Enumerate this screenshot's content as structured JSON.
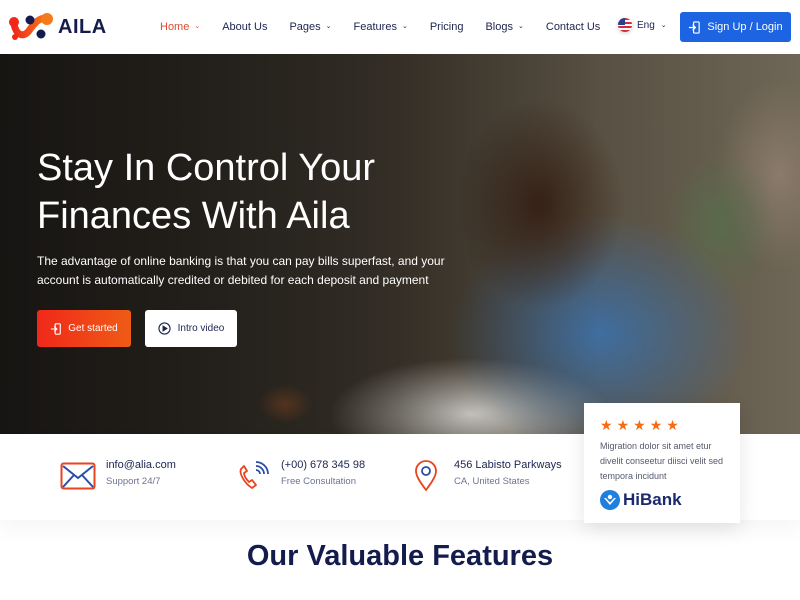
{
  "header": {
    "brand": "AILA",
    "nav": [
      {
        "label": "Home",
        "has_dropdown": true,
        "active": true
      },
      {
        "label": "About Us",
        "has_dropdown": false,
        "active": false
      },
      {
        "label": "Pages",
        "has_dropdown": true,
        "active": false
      },
      {
        "label": "Features",
        "has_dropdown": true,
        "active": false
      },
      {
        "label": "Pricing",
        "has_dropdown": false,
        "active": false
      },
      {
        "label": "Blogs",
        "has_dropdown": true,
        "active": false
      },
      {
        "label": "Contact Us",
        "has_dropdown": false,
        "active": false
      }
    ],
    "language": "Eng",
    "signup_label": "Sign Up / Login"
  },
  "hero": {
    "title": "Stay In Control Your Finances With Aila",
    "subtitle": "The advantage of online banking is that you can pay bills superfast, and your account is automatically credited or debited for each deposit and payment",
    "primary_button": "Get started",
    "secondary_button": "Intro video"
  },
  "contact": [
    {
      "icon": "envelope-icon",
      "title": "info@alia.com",
      "subtitle": "Support 24/7"
    },
    {
      "icon": "phone-icon",
      "title": "(+00) 678 345 98",
      "subtitle": "Free Consultation"
    },
    {
      "icon": "location-pin-icon",
      "title": "456 Labisto Parkways",
      "subtitle": "CA, United States"
    }
  ],
  "review": {
    "rating": 5,
    "max_rating": 5,
    "text": "Migration dolor sit amet etur divelit conseetur diisci velit sed tempora incidunt",
    "company": "HiBank"
  },
  "features": {
    "title": "Our Valuable Features"
  },
  "colors": {
    "accent_red": "#e34a2c",
    "primary_blue": "#1d64e2",
    "navy": "#141c4d",
    "star_orange": "#f86b10"
  }
}
